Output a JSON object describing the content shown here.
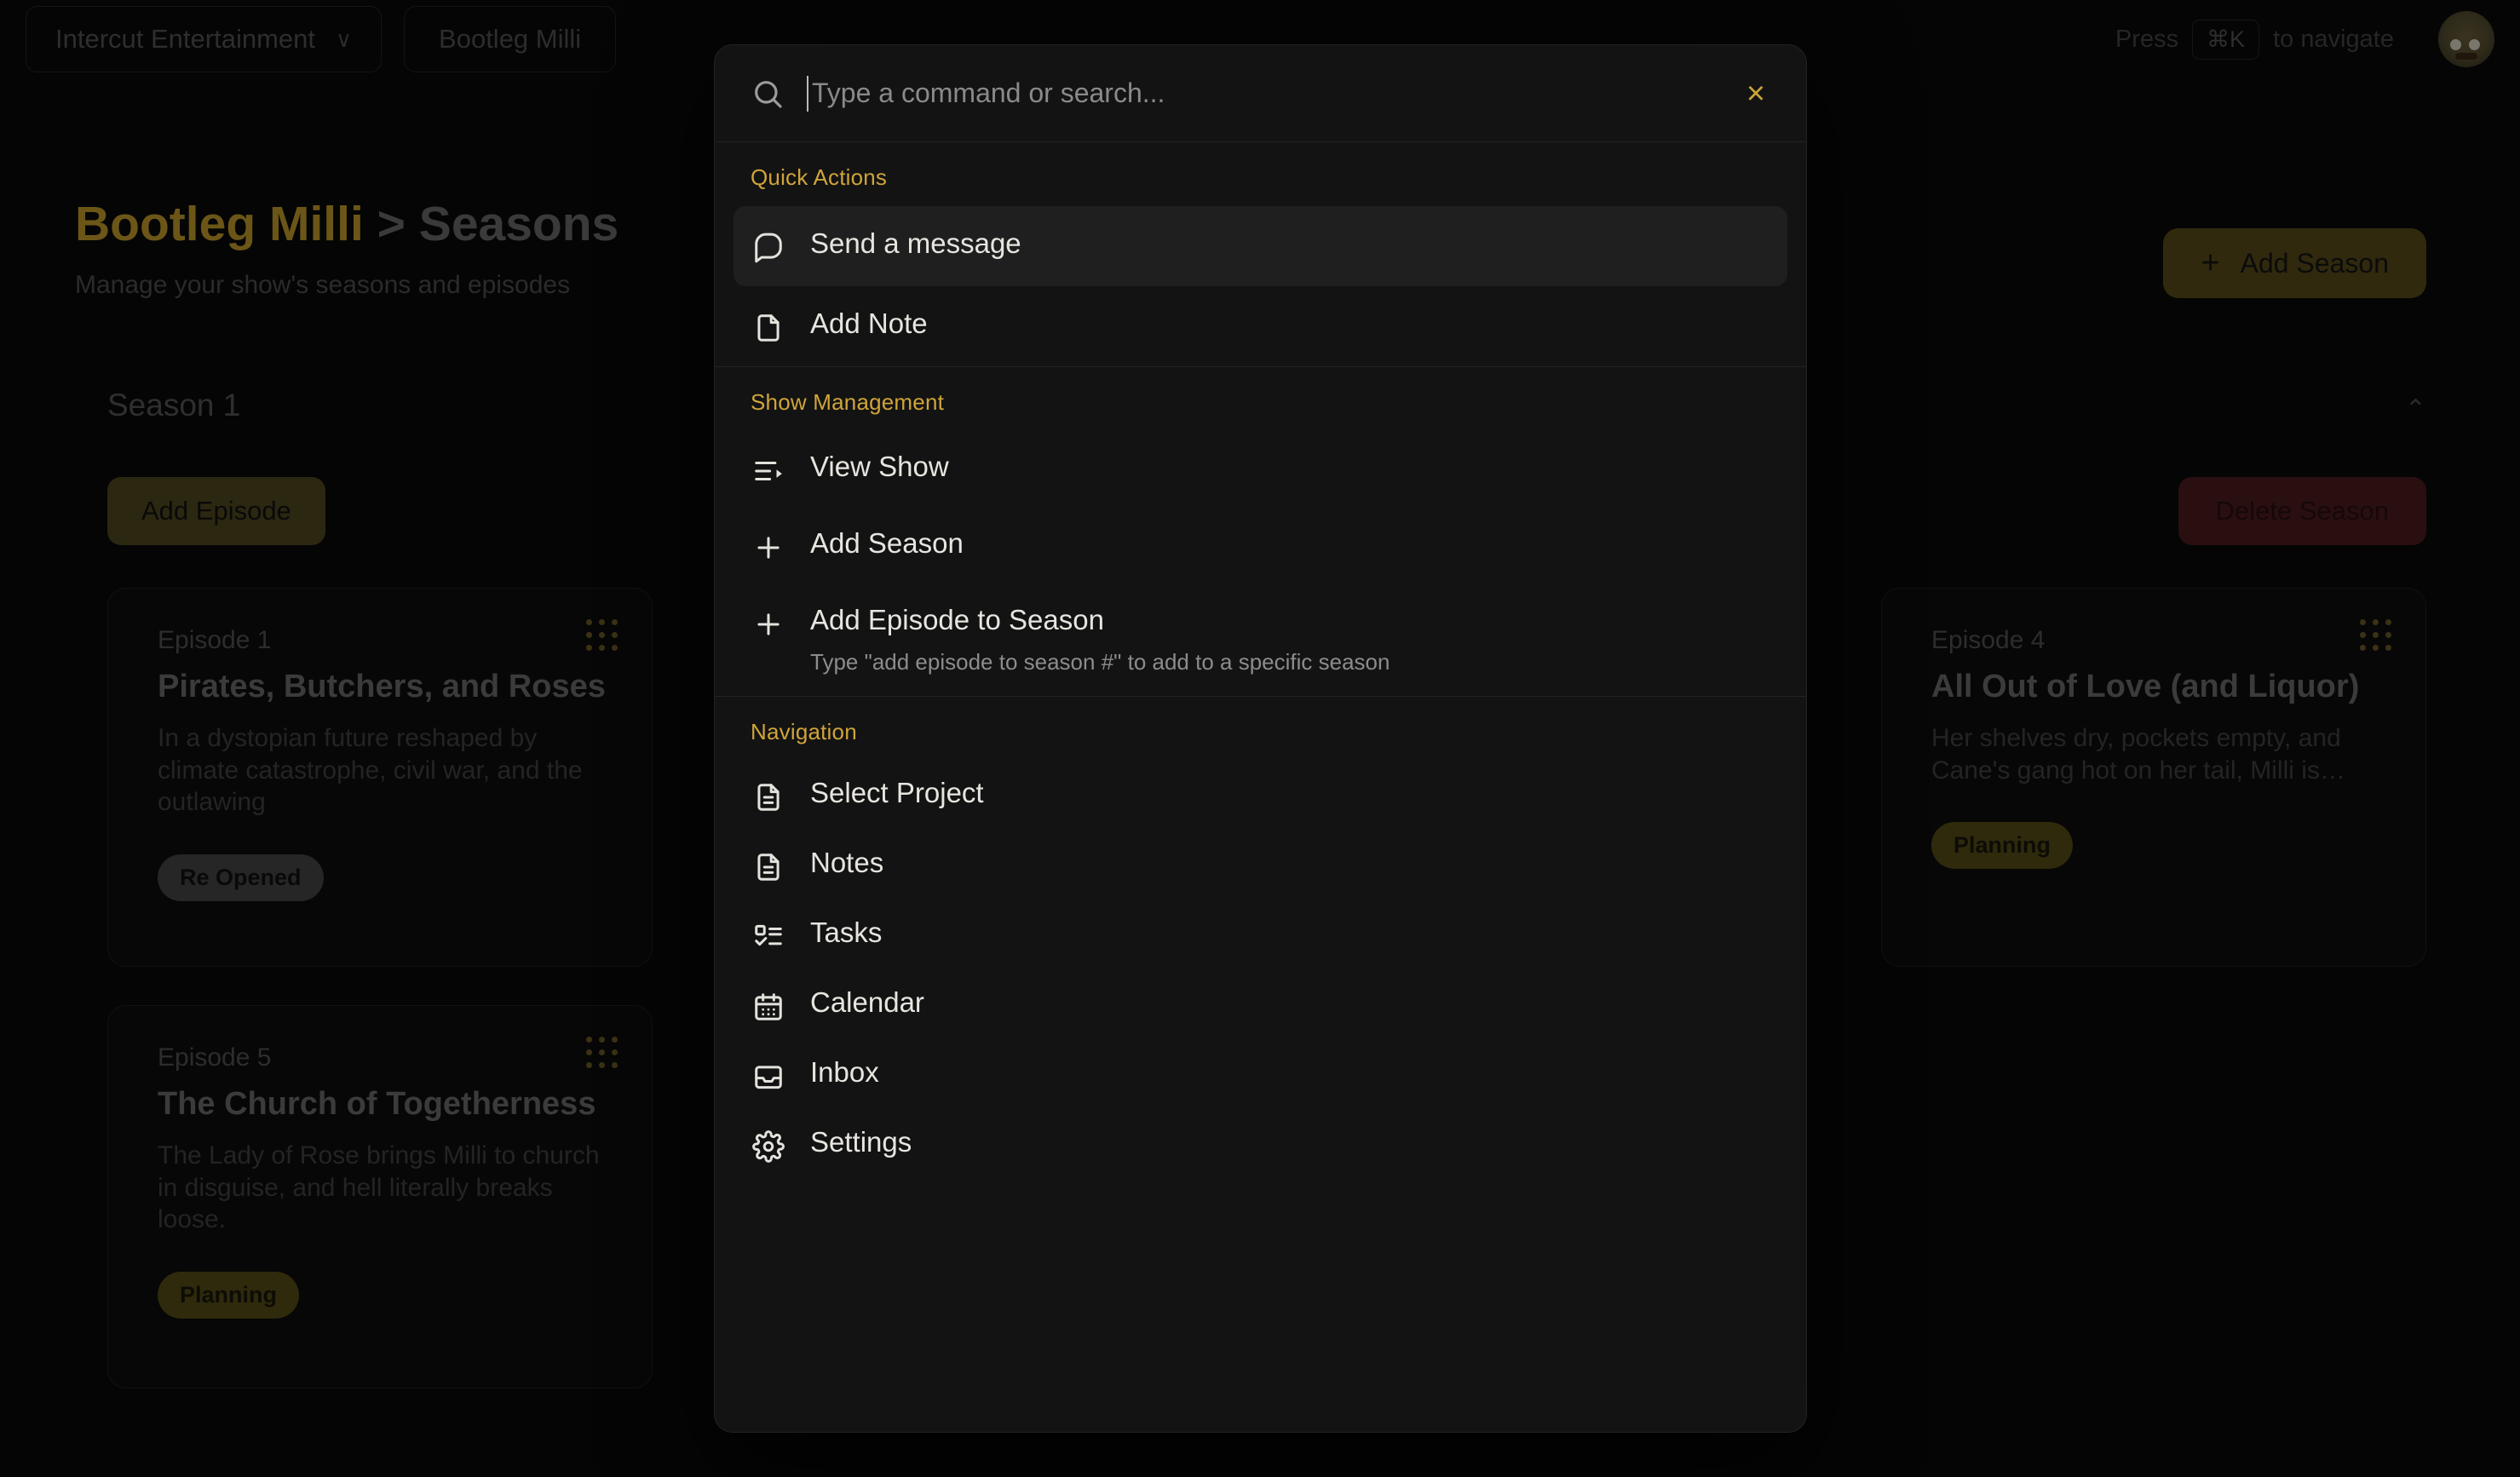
{
  "topbar": {
    "org_name": "Intercut Entertainment",
    "org_chevron": "∨",
    "project_name": "Bootleg Milli",
    "press_label": "Press",
    "shortcut_key": "⌘K",
    "navigate_label": "to navigate",
    "avatar_name": "user-avatar"
  },
  "page": {
    "show_name": "Bootleg Milli",
    "separator": ">",
    "section": "Seasons",
    "subtitle": "Manage your show's seasons and episodes",
    "add_season_label": "Add Season",
    "add_season_plus": "+"
  },
  "season": {
    "label": "Season 1",
    "collapse_icon": "⌃",
    "add_episode_label": "Add Episode",
    "delete_season_label": "Delete Season"
  },
  "episodes": [
    {
      "number": "Episode 1",
      "title": "Pirates, Butchers, and Roses",
      "description": "In a dystopian future reshaped by climate catastrophe, civil war, and the outlawing",
      "status": "Re Opened"
    },
    {
      "number": "Episode 5",
      "title": "The Church of Togetherness",
      "description": "The Lady of Rose brings Milli to church in disguise, and hell literally breaks loose.",
      "status": "Planning"
    },
    {
      "number": "Episode 4",
      "title": "All Out of Love (and Liquor)",
      "description": "Her shelves dry, pockets empty, and Cane's gang hot on her tail, Milli is…",
      "status": "Planning"
    }
  ],
  "palette": {
    "search_placeholder": "Type a command or search...",
    "search_value": "",
    "close_label": "×",
    "groups": [
      {
        "title": "Quick Actions",
        "items": [
          {
            "label": "Send a message",
            "icon": "message-square-icon",
            "selected": true
          },
          {
            "label": "Add Note",
            "icon": "file-icon",
            "selected": false
          }
        ]
      },
      {
        "title": "Show Management",
        "items": [
          {
            "label": "View Show",
            "icon": "list-play-icon",
            "selected": false
          },
          {
            "label": "Add Season",
            "icon": "plus-icon",
            "selected": false
          },
          {
            "label": "Add Episode to Season",
            "icon": "plus-icon",
            "selected": false,
            "sublabel": "Type \"add episode to season #\" to add to a specific season"
          }
        ]
      },
      {
        "title": "Navigation",
        "items": [
          {
            "label": "Select Project",
            "icon": "file-text-icon",
            "selected": false
          },
          {
            "label": "Notes",
            "icon": "file-text-icon",
            "selected": false
          },
          {
            "label": "Tasks",
            "icon": "list-checks-icon",
            "selected": false
          },
          {
            "label": "Calendar",
            "icon": "calendar-icon",
            "selected": false
          },
          {
            "label": "Inbox",
            "icon": "inbox-icon",
            "selected": false
          },
          {
            "label": "Settings",
            "icon": "gear-icon",
            "selected": false
          }
        ]
      }
    ]
  },
  "colors": {
    "accent_gold": "#cfa43a",
    "palette_bg": "#131313",
    "selected_row": "#1f1f1f",
    "border": "#232323",
    "page_bg": "#050505"
  }
}
